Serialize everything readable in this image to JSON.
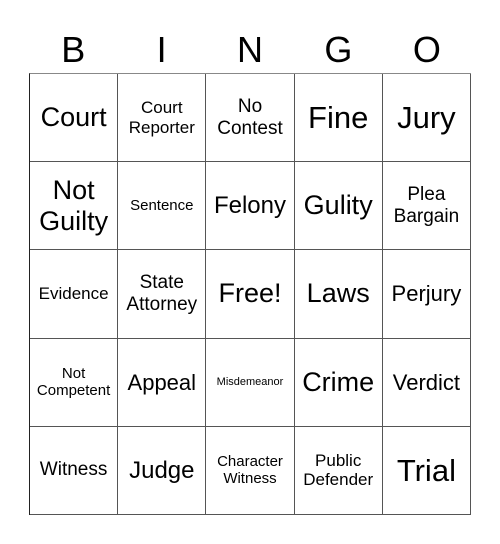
{
  "header": {
    "letters": [
      "B",
      "I",
      "N",
      "G",
      "O"
    ]
  },
  "board": {
    "rows": [
      [
        "Court",
        "Court Reporter",
        "No Contest",
        "Fine",
        "Jury"
      ],
      [
        "Not Guilty",
        "Sentence",
        "Felony",
        "Gulity",
        "Plea Bargain"
      ],
      [
        "Evidence",
        "State Attorney",
        "Free!",
        "Laws",
        "Perjury"
      ],
      [
        "Not Competent",
        "Appeal",
        "Misdemeanor",
        "Crime",
        "Verdict"
      ],
      [
        "Witness",
        "Judge",
        "Character Witness",
        "Public Defender",
        "Trial"
      ]
    ]
  }
}
